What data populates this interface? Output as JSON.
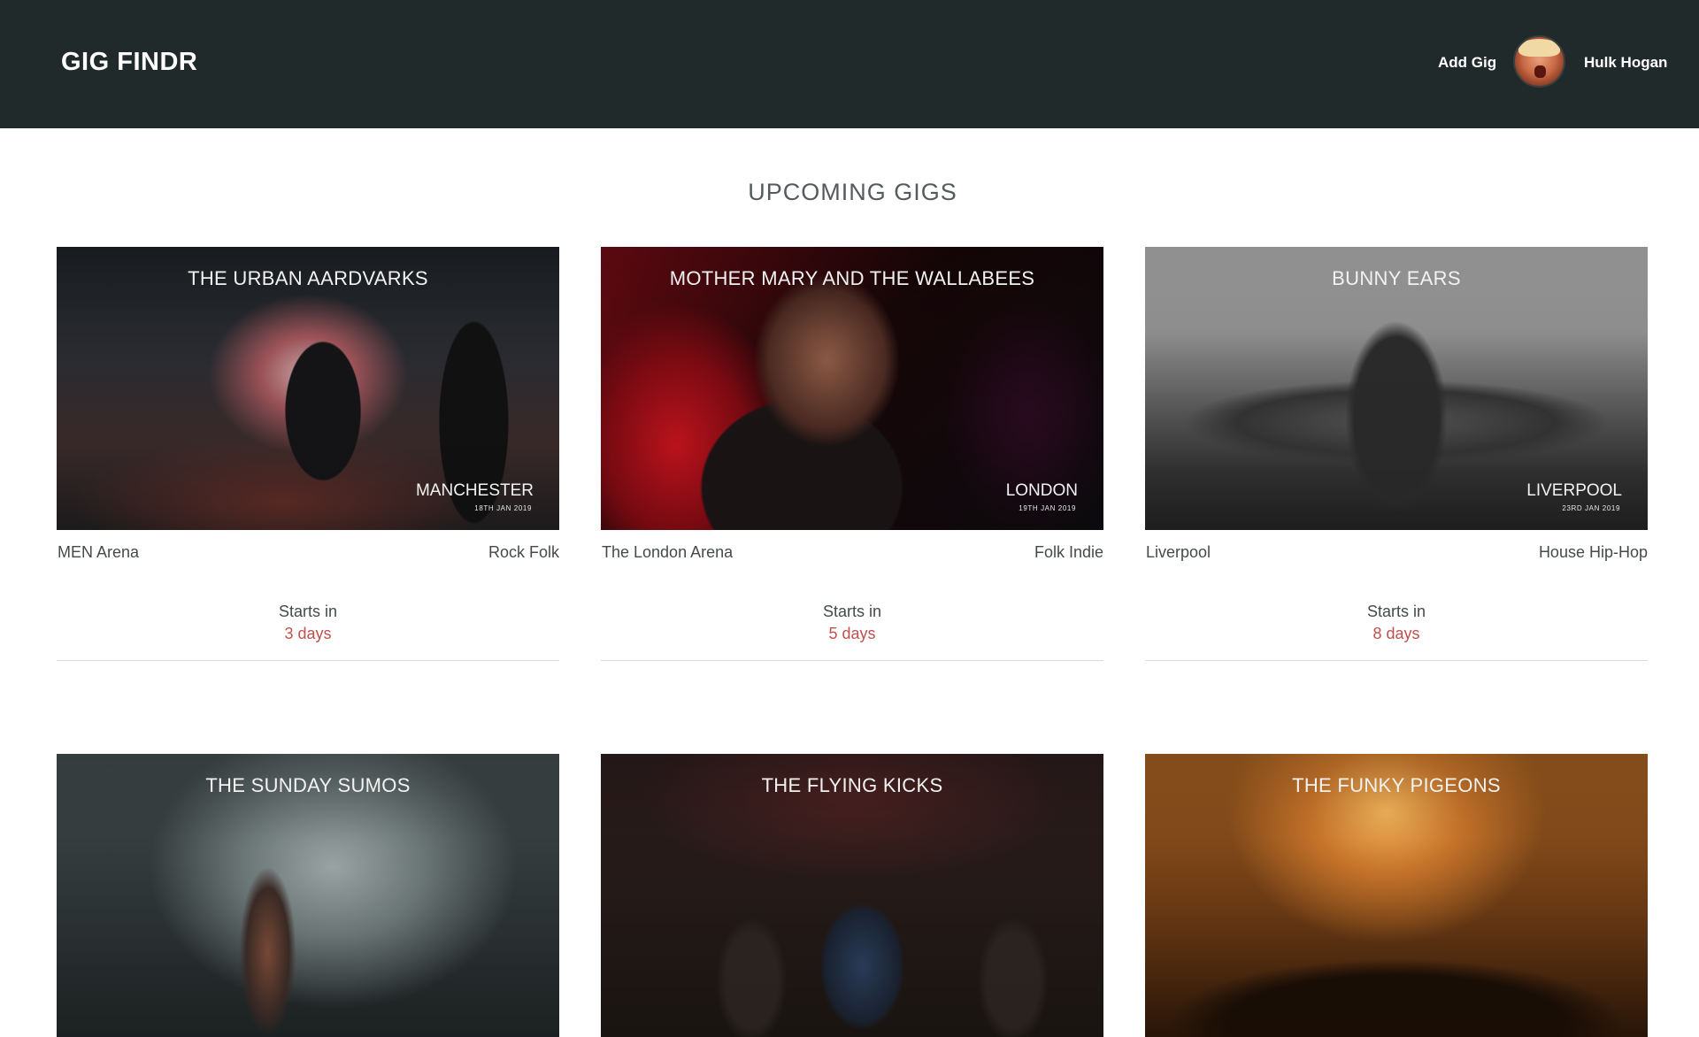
{
  "header": {
    "brand": "GIG FINDR",
    "add_gig_label": "Add Gig",
    "user_name": "Hulk Hogan",
    "background_color": "#212a2b"
  },
  "main": {
    "section_title": "UPCOMING GIGS"
  },
  "gigs": [
    {
      "band": "THE URBAN AARDVARKS",
      "city": "MANCHESTER",
      "date": "18TH JAN 2019",
      "venue": "MEN Arena",
      "genres": "Rock Folk",
      "starts_label": "Starts in",
      "days": "3 days"
    },
    {
      "band": "MOTHER MARY AND THE WALLABEES",
      "city": "LONDON",
      "date": "19TH JAN 2019",
      "venue": "The London Arena",
      "genres": "Folk Indie",
      "starts_label": "Starts in",
      "days": "5 days"
    },
    {
      "band": "BUNNY EARS",
      "city": "LIVERPOOL",
      "date": "23RD JAN 2019",
      "venue": "Liverpool",
      "genres": "House Hip-Hop",
      "starts_label": "Starts in",
      "days": "8 days"
    },
    {
      "band": "THE SUNDAY SUMOS"
    },
    {
      "band": "THE FLYING KICKS"
    },
    {
      "band": "THE FUNKY PIGEONS"
    }
  ],
  "colors": {
    "accent_days": "#c0504d",
    "text": "#444a4c",
    "divider": "#d9dcdd"
  }
}
